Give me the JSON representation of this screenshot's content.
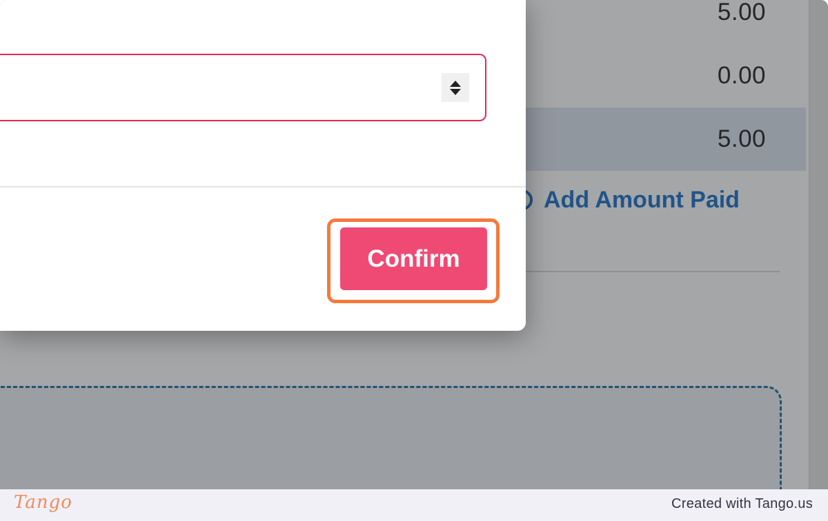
{
  "background": {
    "amount_rows": [
      {
        "value": "5.00",
        "highlighted": false
      },
      {
        "value": "0.00",
        "highlighted": false
      },
      {
        "value": "5.00",
        "highlighted": true
      }
    ],
    "add_amount_link": "Add Amount Paid",
    "add_icon": "plus-circle-icon"
  },
  "modal": {
    "input_value": "",
    "spinner_icon": "number-spinner-icon",
    "confirm_label": "Confirm"
  },
  "footer": {
    "logo": "Tango",
    "credit": "Created with Tango.us"
  },
  "colors": {
    "confirm_button": "#ef4a73",
    "input_border": "#e8264f",
    "highlight_ring": "#f47a3b",
    "link": "#1a73c8"
  }
}
